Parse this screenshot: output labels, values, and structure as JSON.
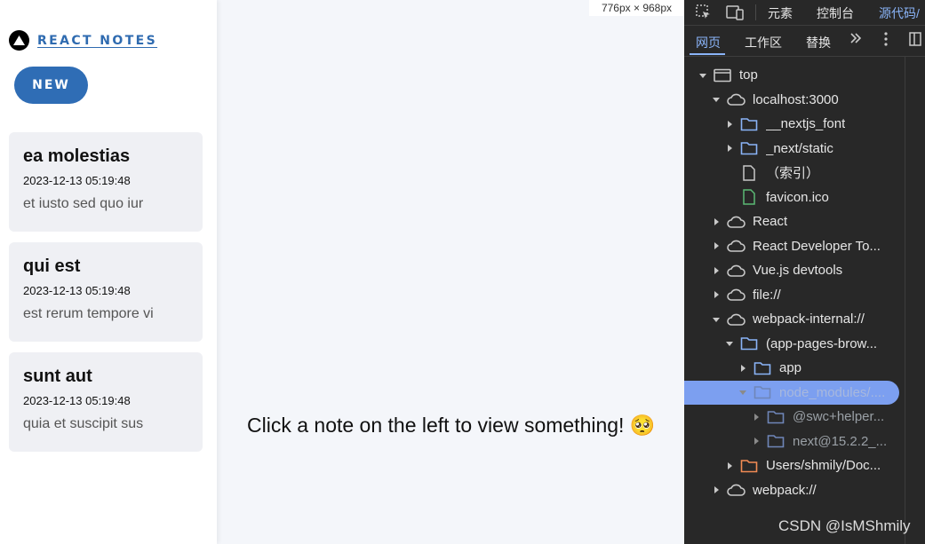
{
  "viewport_size": "776px × 968px",
  "sidebar": {
    "logo_text": "REACT NOTES",
    "new_button": "NEW",
    "notes": [
      {
        "title": "ea molestias",
        "time": "2023-12-13 05:19:48",
        "excerpt": "et iusto sed quo iur"
      },
      {
        "title": "qui est",
        "time": "2023-12-13 05:19:48",
        "excerpt": "est rerum tempore vi"
      },
      {
        "title": "sunt aut",
        "time": "2023-12-13 05:19:48",
        "excerpt": "quia et suscipit sus"
      }
    ]
  },
  "main": {
    "placeholder": "Click a note on the left to view something! 🥺"
  },
  "devtools": {
    "top_tabs": [
      "元素",
      "控制台",
      "源代码/"
    ],
    "sub_tabs": [
      "网页",
      "工作区",
      "替换"
    ],
    "tree": [
      {
        "label": "top",
        "icon": "window-icon",
        "arrow": "down"
      },
      {
        "label": "localhost:3000",
        "icon": "cloud-icon",
        "arrow": "down"
      },
      {
        "label": "__nextjs_font",
        "icon": "folder-icon",
        "arrow": "right"
      },
      {
        "label": "_next/static",
        "icon": "folder-icon",
        "arrow": "right"
      },
      {
        "label": "（索引）",
        "icon": "file-icon",
        "arrow": "none"
      },
      {
        "label": "favicon.ico",
        "icon": "file-green-icon",
        "arrow": "none"
      },
      {
        "label": "React",
        "icon": "cloud-icon",
        "arrow": "right"
      },
      {
        "label": "React Developer To...",
        "icon": "cloud-icon",
        "arrow": "right"
      },
      {
        "label": "Vue.js devtools",
        "icon": "cloud-icon",
        "arrow": "right"
      },
      {
        "label": "file://",
        "icon": "cloud-icon",
        "arrow": "right"
      },
      {
        "label": "webpack-internal://",
        "icon": "cloud-icon",
        "arrow": "down"
      },
      {
        "label": "(app-pages-brow...",
        "icon": "folder-icon",
        "arrow": "down"
      },
      {
        "label": "app",
        "icon": "folder-icon",
        "arrow": "right"
      },
      {
        "label": "node_modules/....",
        "icon": "folder-icon",
        "arrow": "down"
      },
      {
        "label": "@swc+helper...",
        "icon": "folder-icon",
        "arrow": "right"
      },
      {
        "label": "next@15.2.2_...",
        "icon": "folder-icon",
        "arrow": "right"
      },
      {
        "label": "Users/shmily/Doc...",
        "icon": "folder-orange-icon",
        "arrow": "right"
      },
      {
        "label": "webpack://",
        "icon": "cloud-icon",
        "arrow": "right"
      }
    ]
  },
  "watermark": "CSDN @IsMShmily",
  "colors": {
    "accent": "#2f6db5",
    "devtools_bg": "#282828",
    "selected": "#7c9ff0",
    "folder": "#8ab4f8",
    "orange_folder": "#f28b54",
    "green_file": "#5bb974"
  }
}
